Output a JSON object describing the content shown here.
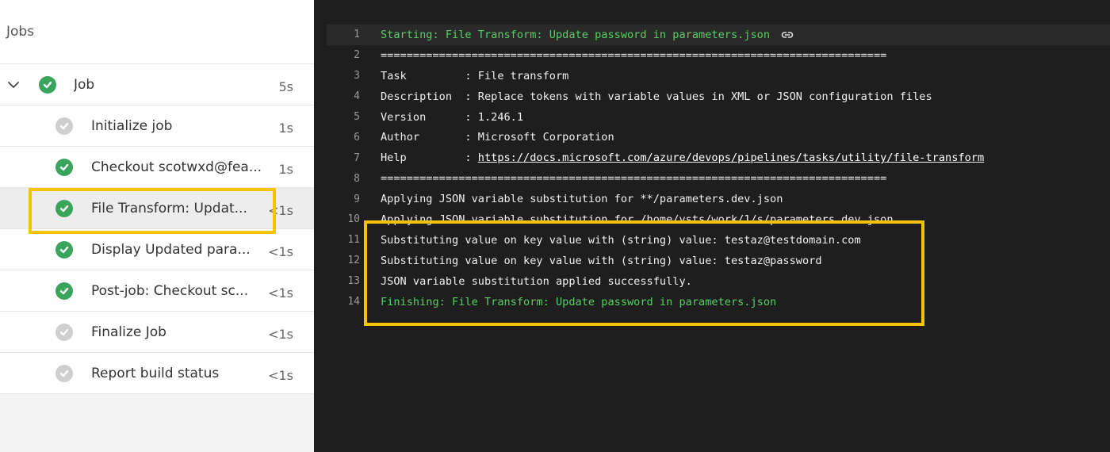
{
  "jobs_panel": {
    "title": "Jobs",
    "job": {
      "label": "Job",
      "duration": "5s",
      "status": "success",
      "expanded": true
    },
    "steps": [
      {
        "label": "Initialize job",
        "duration": "1s",
        "status": "skipped"
      },
      {
        "label": "Checkout scotwxd@fea...",
        "duration": "1s",
        "status": "success"
      },
      {
        "label": "File Transform: Updat...",
        "duration": "<1s",
        "status": "success",
        "selected": true
      },
      {
        "label": "Display Updated para...",
        "duration": "<1s",
        "status": "success"
      },
      {
        "label": "Post-job: Checkout sc...",
        "duration": "<1s",
        "status": "success"
      },
      {
        "label": "Finalize Job",
        "duration": "<1s",
        "status": "skipped"
      },
      {
        "label": "Report build status",
        "duration": "<1s",
        "status": "skipped"
      }
    ]
  },
  "log": {
    "lines": [
      {
        "num": "1",
        "text": "Starting: File Transform: Update password in parameters.json",
        "style": "green"
      },
      {
        "num": "2",
        "text": "=============================================================================="
      },
      {
        "num": "3",
        "text": "Task         : File transform"
      },
      {
        "num": "4",
        "text": "Description  : Replace tokens with variable values in XML or JSON configuration files"
      },
      {
        "num": "5",
        "text": "Version      : 1.246.1"
      },
      {
        "num": "6",
        "text": "Author       : Microsoft Corporation"
      },
      {
        "num": "7",
        "text_prefix": "Help         : ",
        "link": "https://docs.microsoft.com/azure/devops/pipelines/tasks/utility/file-transform"
      },
      {
        "num": "8",
        "text": "=============================================================================="
      },
      {
        "num": "9",
        "text": "Applying JSON variable substitution for **/parameters.dev.json"
      },
      {
        "num": "10",
        "text": "Applying JSON variable substitution for /home/vsts/work/1/s/parameters.dev.json"
      },
      {
        "num": "11",
        "text": "Substituting value on key value with (string) value: testaz@testdomain.com"
      },
      {
        "num": "12",
        "text": "Substituting value on key value with (string) value: testaz@password"
      },
      {
        "num": "13",
        "text": "JSON variable substitution applied successfully."
      },
      {
        "num": "14",
        "text": "Finishing: File Transform: Update password in parameters.json",
        "style": "green"
      }
    ]
  },
  "colors": {
    "success": "#3aa35c",
    "skipped": "#cfcfcf",
    "highlight": "#f5c400",
    "log_bg": "#1e1e1e",
    "log_green": "#55d062"
  }
}
